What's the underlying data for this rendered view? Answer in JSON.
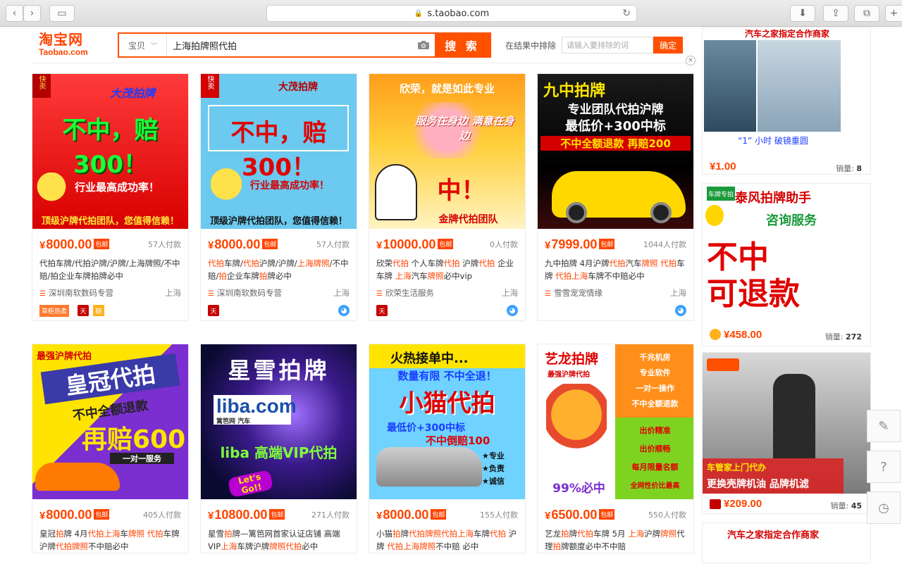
{
  "browser": {
    "url": "s.taobao.com"
  },
  "header": {
    "logo_cn": "淘宝网",
    "logo_en": "Taobao.com",
    "search_category": "宝贝",
    "search_query": "上海拍牌照代拍",
    "search_button": "搜 索",
    "exclude_label": "在结果中排除",
    "exclude_placeholder": "请输入要排除的词",
    "exclude_button": "确定"
  },
  "products": [
    {
      "img_lines": [
        "不中，赔300！",
        "行业最高成功率！",
        "顶级沪牌代拍团队，您值得信赖！"
      ],
      "img_top": "大茂拍牌",
      "price": "8000.00",
      "sold": "57人付款",
      "title_parts": [
        {
          "t": "代拍车牌/代拍沪牌/沪牌/上海牌照/不中赔/拍企业车牌拍牌必中",
          "h": false
        }
      ],
      "shop": "深圳南软数码专营",
      "location": "上海",
      "tag_orange": "草柜热卖",
      "tag_tmall": "天",
      "tag_yellow": "赔"
    },
    {
      "img_lines": [
        "不中，赔300！",
        "行业最高成功率！",
        "顶级沪牌代拍团队，您值得信赖！"
      ],
      "img_top": "大茂拍牌",
      "price": "8000.00",
      "sold": "57人付款",
      "title_parts": [
        {
          "t": "代拍",
          "h": true
        },
        {
          "t": "车牌/",
          "h": false
        },
        {
          "t": "代拍",
          "h": true
        },
        {
          "t": "沪牌/沪牌/",
          "h": false
        },
        {
          "t": "上海牌照",
          "h": true
        },
        {
          "t": "/不中赔/",
          "h": false
        },
        {
          "t": "拍",
          "h": true
        },
        {
          "t": "企业车牌",
          "h": false
        },
        {
          "t": "拍",
          "h": true
        },
        {
          "t": "牌必中",
          "h": false
        }
      ],
      "shop": "深圳南软数码专营",
      "location": "上海",
      "tag_tmall": "天"
    },
    {
      "img_lines": [
        "欣荣，就是如此专业",
        "服务在身边 满意在身边",
        "中！",
        "金牌代拍团队"
      ],
      "price": "10000.00",
      "sold": "0人付款",
      "title_parts": [
        {
          "t": "欣荣",
          "h": false
        },
        {
          "t": "代拍",
          "h": true
        },
        {
          "t": " 个人车牌",
          "h": false
        },
        {
          "t": "代拍",
          "h": true
        },
        {
          "t": " 沪牌",
          "h": false
        },
        {
          "t": "代拍",
          "h": true
        },
        {
          "t": " 企业车牌 ",
          "h": false
        },
        {
          "t": "上海",
          "h": true
        },
        {
          "t": "汽车",
          "h": false
        },
        {
          "t": "牌照",
          "h": true
        },
        {
          "t": "必中vip",
          "h": false
        }
      ],
      "shop": "欣荣生活服务",
      "location": "上海",
      "tag_tmall": "天"
    },
    {
      "img_lines": [
        "九中拍牌",
        "专业团队代拍沪牌",
        "最低价+300中标",
        "不中全额退款 再赔200"
      ],
      "price": "7999.00",
      "sold": "1044人付款",
      "title_parts": [
        {
          "t": "九中拍牌 4月沪牌",
          "h": false
        },
        {
          "t": "代拍",
          "h": true
        },
        {
          "t": "汽车",
          "h": false
        },
        {
          "t": "牌照 代拍",
          "h": true
        },
        {
          "t": "车牌 ",
          "h": false
        },
        {
          "t": "代拍上海",
          "h": true
        },
        {
          "t": "车牌不中赔必中",
          "h": false
        }
      ],
      "shop": "雪雪宠宠情缘",
      "location": "上海"
    },
    {
      "img_lines": [
        "最强沪牌代拍",
        "皇冠代拍",
        "不中全额退款",
        "再赔600",
        "一对一服务"
      ],
      "price": "8000.00",
      "sold": "405人付款",
      "title_parts": [
        {
          "t": "皇冠",
          "h": false
        },
        {
          "t": "拍",
          "h": true
        },
        {
          "t": "牌 4月",
          "h": false
        },
        {
          "t": "代拍上海",
          "h": true
        },
        {
          "t": "车",
          "h": false
        },
        {
          "t": "牌照 代拍",
          "h": true
        },
        {
          "t": "车牌 沪牌",
          "h": false
        },
        {
          "t": "代拍牌照",
          "h": true
        },
        {
          "t": "不中赔必中",
          "h": false
        }
      ]
    },
    {
      "img_lines": [
        "星雪拍牌",
        "liba.com",
        "篱笆网 汽车",
        "liba 高端VIP代拍",
        "Let's Go!!"
      ],
      "price": "10800.00",
      "sold": "271人付款",
      "title_parts": [
        {
          "t": "星雪",
          "h": false
        },
        {
          "t": "拍",
          "h": true
        },
        {
          "t": "牌—篱笆网首家认证店铺 高端VIP",
          "h": false
        },
        {
          "t": "上海",
          "h": true
        },
        {
          "t": "车牌沪牌",
          "h": false
        },
        {
          "t": "牌照代拍",
          "h": true
        },
        {
          "t": "必中",
          "h": false
        }
      ]
    },
    {
      "img_lines": [
        "火热接单中...",
        "数量有限 不中全退！",
        "小猫代拍",
        "最低价+300中标",
        "不中倒赔100",
        "★专业",
        "★负责",
        "★诚信"
      ],
      "price": "8000.00",
      "sold": "155人付款",
      "title_parts": [
        {
          "t": "小猫",
          "h": false
        },
        {
          "t": "拍",
          "h": true
        },
        {
          "t": "牌",
          "h": false
        },
        {
          "t": "代拍牌照代拍上海",
          "h": true
        },
        {
          "t": "车牌",
          "h": false
        },
        {
          "t": "代拍",
          "h": true
        },
        {
          "t": " 沪牌 ",
          "h": false
        },
        {
          "t": "代拍上海牌照",
          "h": true
        },
        {
          "t": "不中赔 必中",
          "h": false
        }
      ]
    },
    {
      "img_lines": [
        "艺龙拍牌",
        "最强沪牌代拍",
        "千兆机房",
        "专业软件",
        "一对一操作",
        "不中全额退款",
        "出价精准",
        "出价顺畅",
        "每月限量名额",
        "全网性价比最高",
        "99%必中"
      ],
      "price": "6500.00",
      "sold": "550人付款",
      "title_parts": [
        {
          "t": "艺龙",
          "h": false
        },
        {
          "t": "拍",
          "h": true
        },
        {
          "t": "牌",
          "h": false
        },
        {
          "t": "代拍",
          "h": true
        },
        {
          "t": "车牌 5月 ",
          "h": false
        },
        {
          "t": "上海",
          "h": true
        },
        {
          "t": "沪牌",
          "h": false
        },
        {
          "t": "牌照",
          "h": true
        },
        {
          "t": "代理",
          "h": false
        },
        {
          "t": "拍",
          "h": true
        },
        {
          "t": "牌额度必中不中赔",
          "h": false
        }
      ]
    }
  ],
  "ads": [
    {
      "banner": "汽车之家指定合作商家",
      "caption": "“1” 小时   破镜重圆",
      "price": "1.00",
      "sold_label": "销量:",
      "sold": "8"
    },
    {
      "top": "车牌专拍",
      "lines": [
        "泰风拍牌助手",
        "咨询服务",
        "不中",
        "可退款"
      ],
      "price": "458.00",
      "sold_label": "销量:",
      "sold": "272"
    },
    {
      "lines": [
        "车管家上门代办",
        "更换壳牌机油 品牌机滤"
      ],
      "price": "209.00",
      "sold_label": "销量:",
      "sold": "45"
    },
    {
      "banner": "汽车之家指定合作商家"
    }
  ],
  "colors": {
    "accent": "#ff4400",
    "search": "#ff5000"
  }
}
